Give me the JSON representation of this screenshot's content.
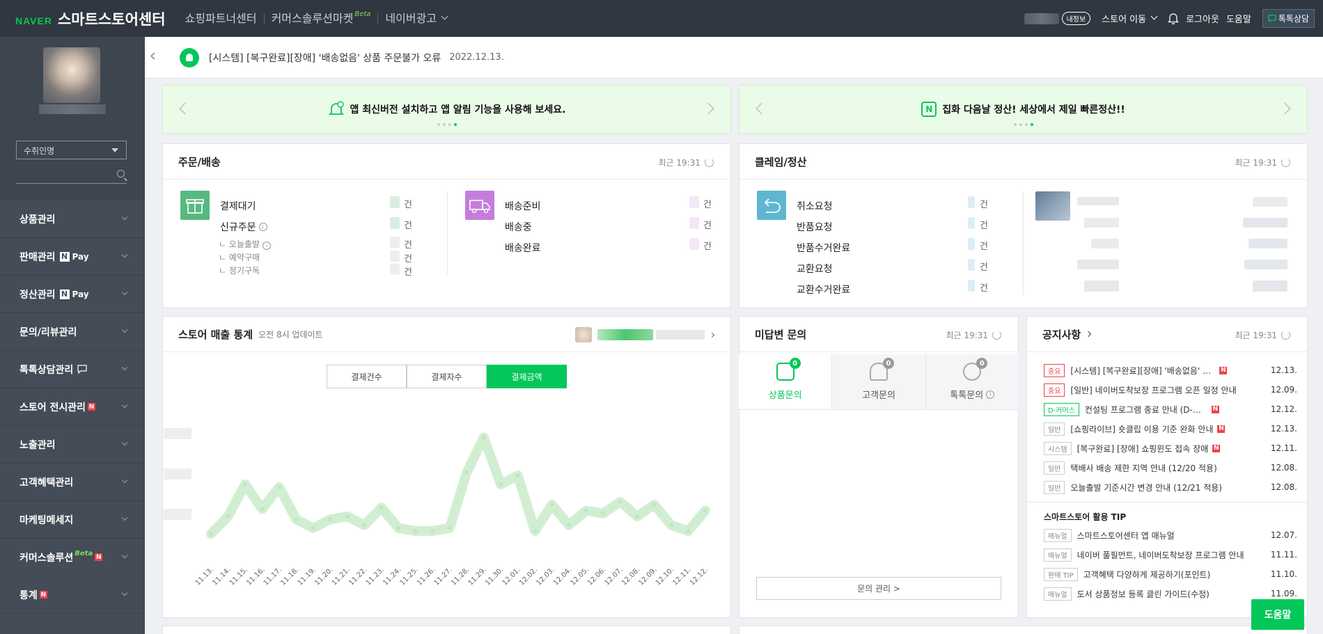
{
  "topbar": {
    "naver": "NAVER",
    "brand": "스마트스토어센터",
    "nav": [
      "쇼핑파트너센터",
      "커머스솔루션마켓",
      "네이버광고"
    ],
    "beta": "Beta",
    "my_badge": "내정보",
    "store_move": "스토어 이동",
    "logout": "로그아웃",
    "help": "도움말",
    "talk": "톡톡상담"
  },
  "sidebar": {
    "select": "수취인명",
    "items": [
      {
        "label": "상품관리"
      },
      {
        "label": "판매관리",
        "pay": "Pay"
      },
      {
        "label": "정산관리",
        "pay": "Pay"
      },
      {
        "label": "문의/리뷰관리"
      },
      {
        "label": "톡톡상담관리"
      },
      {
        "label": "스토어 전시관리"
      },
      {
        "label": "노출관리"
      },
      {
        "label": "고객혜택관리"
      },
      {
        "label": "마케팅메세지"
      },
      {
        "label": "커머스솔루션"
      },
      {
        "label": "통계"
      }
    ],
    "n": "N",
    "beta": "Beta"
  },
  "notice": {
    "text": "[시스템] [복구완료][장애] '배송없음' 상품 주문불가 오류",
    "date": "2022.12.13."
  },
  "banners": [
    {
      "text": "앱 최신버전 설치하고 앱 알림 기능을 사용해 보세요."
    },
    {
      "text": "집화 다음날 정산! 세상에서 제일 빠른정산!!"
    }
  ],
  "order": {
    "title": "주문/배송",
    "recent": "최근 19:31",
    "unit": "건",
    "left": [
      "결제대기",
      "신규주문"
    ],
    "subs": [
      "오늘출발",
      "예약구매",
      "정기구독"
    ],
    "right": [
      "배송준비",
      "배송중",
      "배송완료"
    ]
  },
  "claim": {
    "title": "클레임/정산",
    "recent": "최근 19:31",
    "unit": "건",
    "items": [
      "취소요청",
      "반품요청",
      "반품수거완료",
      "교환요청",
      "교환수거완료"
    ]
  },
  "sales": {
    "title": "스토어 매출 통계",
    "sub": "오전 8시 업데이트",
    "tabs": [
      "결제건수",
      "결제자수",
      "결제금액"
    ],
    "active_tab": "결제금액"
  },
  "chart_data": {
    "type": "line",
    "categories": [
      "11.13.",
      "11.14.",
      "11.15.",
      "11.16.",
      "11.17.",
      "11.18.",
      "11.19.",
      "11.20.",
      "11.21.",
      "11.22.",
      "11.23.",
      "11.24.",
      "11.25.",
      "11.26.",
      "11.27.",
      "11.28.",
      "11.29.",
      "11.30.",
      "12.01.",
      "12.02.",
      "12.03.",
      "12.04.",
      "12.05.",
      "12.06.",
      "12.07.",
      "12.08.",
      "12.09.",
      "12.10.",
      "12.11.",
      "12.12."
    ],
    "values": [
      18,
      30,
      52,
      35,
      50,
      28,
      22,
      28,
      30,
      24,
      36,
      22,
      20,
      20,
      22,
      60,
      84,
      52,
      58,
      20,
      38,
      24,
      34,
      32,
      40,
      30,
      38,
      24,
      20,
      34
    ],
    "ylim": [
      0,
      100
    ],
    "color": "#cdeccd"
  },
  "inquiry": {
    "title": "미답변 문의",
    "recent": "최근 19:31",
    "tabs": [
      {
        "label": "상품문의",
        "count": "0"
      },
      {
        "label": "고객문의",
        "count": "0"
      },
      {
        "label": "톡톡문의",
        "count": "0"
      }
    ],
    "manage": "문의 관리 >"
  },
  "notices": {
    "title": "공지사항",
    "recent": "최근 19:31",
    "items": [
      {
        "tag": "중요",
        "title": "[시스템] [복구완료][장애] '배송없음' 상품 주문불가 오류",
        "date": "12.13."
      },
      {
        "tag": "중요",
        "title": "[일반] 네이버도착보장 프로그램 오픈 일정 안내",
        "date": "12.09."
      },
      {
        "tag": "D-커머스",
        "title": "컨설팅 프로그램 종료 안내 (D-커머스)",
        "date": "12.12."
      },
      {
        "tag": "일반",
        "title": "[쇼핑라이브] 숏클립 이용 기준 완화 안내",
        "date": "12.13."
      },
      {
        "tag": "시스템",
        "title": "[복구완료] [장애] 쇼핑윈도 접속 장애",
        "date": "12.11."
      },
      {
        "tag": "일반",
        "title": "택배사 배송 제한 지역 안내 (12/20 적용)",
        "date": "12.08."
      },
      {
        "tag": "일반",
        "title": "오늘출발 기준시간 변경 안내 (12/21 적용)",
        "date": "12.08."
      }
    ],
    "tip_title": "스마트스토어 활용 TIP",
    "tips": [
      {
        "tag": "매뉴얼",
        "title": "스마트스토어센터 앱 매뉴얼",
        "date": "12.07."
      },
      {
        "tag": "매뉴얼",
        "title": "네이버 풀필먼트, 네이버도착보장 프로그램 안내",
        "date": "11.11."
      },
      {
        "tag": "판매 TIP",
        "title": "고객혜택 다양하게 제공하기(포인트)",
        "date": "11.10."
      },
      {
        "tag": "매뉴얼",
        "title": "도서 상품정보 등록 클린 가이드(수정)",
        "date": "11.09."
      }
    ]
  },
  "help_button": "도움말"
}
